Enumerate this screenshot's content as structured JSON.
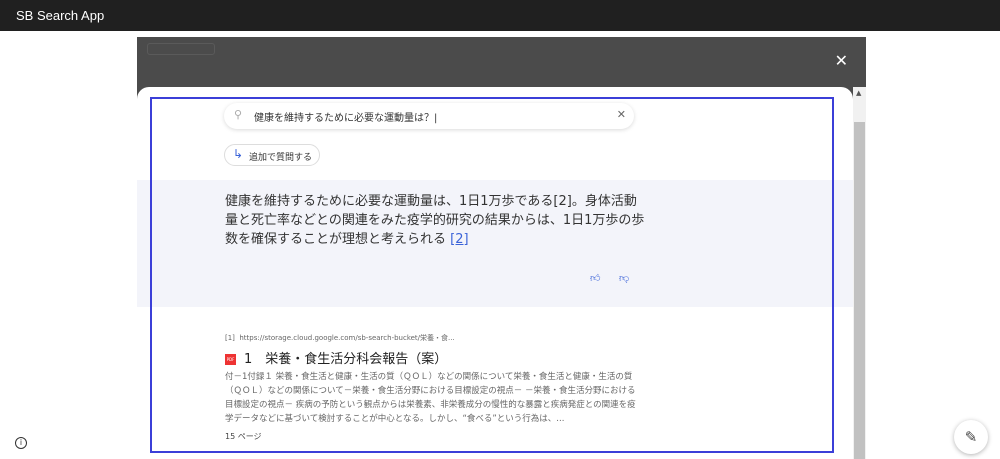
{
  "app": {
    "title": "SB Search App"
  },
  "search": {
    "query": "健康を維持するために必要な運動量は？",
    "clear_icon": "close-icon",
    "search_icon": "search-icon"
  },
  "follow_up": {
    "label": "追加で質問する"
  },
  "answer": {
    "text": "健康を維持するために必要な運動量は、1日1万歩である[2]。身体活動量と死亡率などとの関連をみた疫学的研究の結果からは、1日1万歩の歩数を確保することが理想と考えられる",
    "citation": "[2]"
  },
  "results": [
    {
      "index": "[1]",
      "url": "https://storage.cloud.google.com/sb-search-bucket/栄養・食...",
      "file_type": "PDF",
      "title": "1　栄養・食生活分科会報告（案）",
      "snippet": "付－1付録１ 栄養・食生活と健康・生活の質（ＱＯＬ）などの関係について栄養・食生活と健康・生活の質（ＱＯＬ）などの関係について－栄養・食生活分野における目標設定の視点－ －栄養・食生活分野における目標設定の視点－ 疾病の予防という観点からは栄養素、非栄養成分の慢性的な暴露と疾病発症との関連を疫学データなどに基づいて検討することが中心となる。しかし、“食べる”という行為は、...",
      "pages": "15 ページ"
    }
  ],
  "colors": {
    "accent": "#3b63d8",
    "highlight_outline": "#3b3fd8"
  }
}
